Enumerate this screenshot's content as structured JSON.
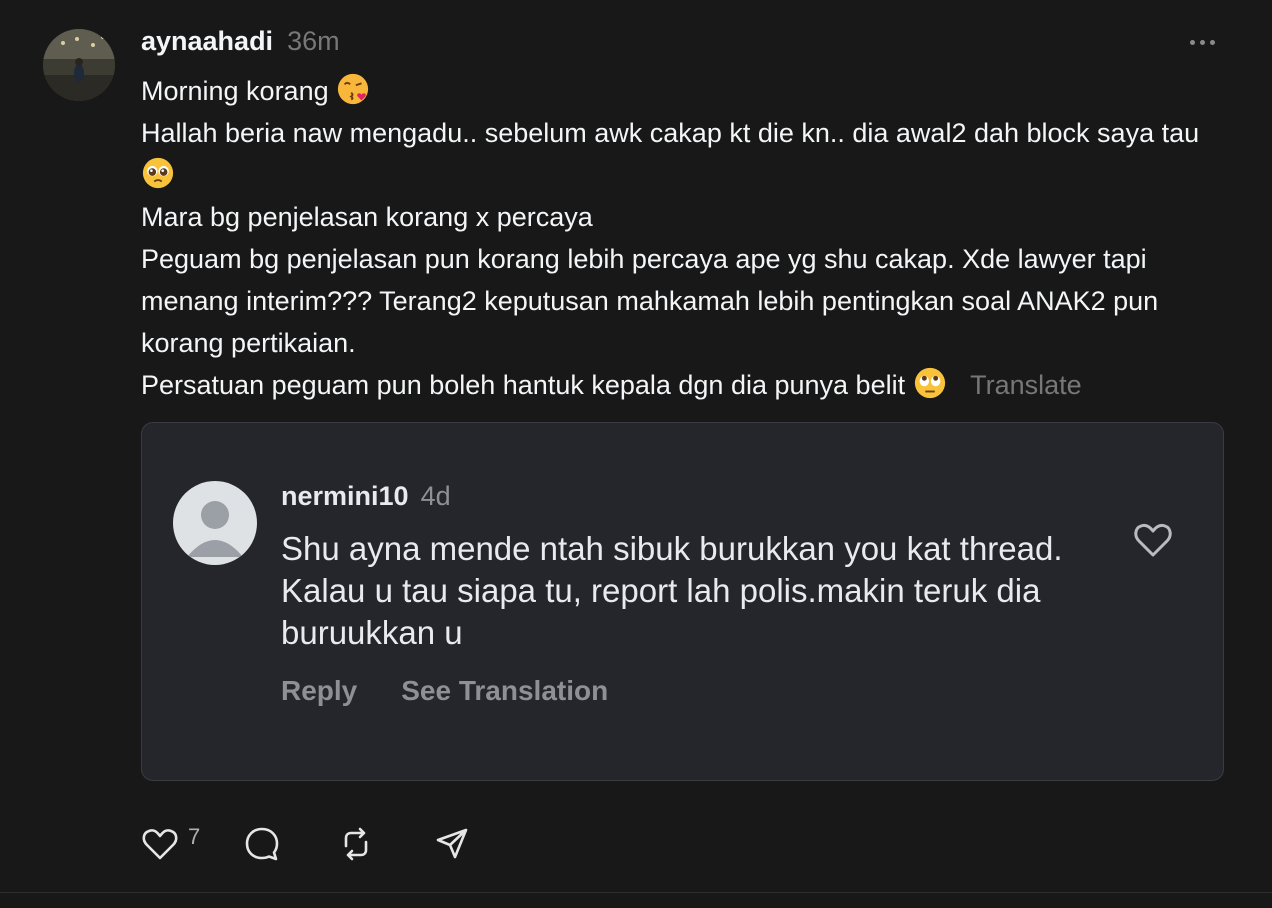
{
  "post": {
    "username": "aynaahadi",
    "time": "36m",
    "lines": [
      "Morning korang",
      "Hallah beria naw mengadu.. sebelum awk cakap kt die kn.. dia awal2 dah block saya tau",
      "Mara bg penjelasan korang x percaya",
      "Peguam bg penjelasan pun korang lebih percaya ape yg shu cakap. Xde lawyer tapi menang interim??? Terang2 keputusan mahkamah lebih pentingkan soal ANAK2 pun korang pertikaian.",
      "Persatuan peguam pun boleh hantuk kepala dgn dia punya belit"
    ],
    "translate_label": "Translate"
  },
  "quoted": {
    "username": "nermini10",
    "time": "4d",
    "text": "Shu ayna mende ntah sibuk burukkan you kat thread. Kalau u tau siapa tu, report lah polis.makin teruk dia buruukkan u",
    "reply_label": "Reply",
    "see_translation_label": "See Translation"
  },
  "actions": {
    "like_count": "7"
  },
  "icons": [
    "more-icon",
    "kiss-emoji",
    "pleading-emoji",
    "eye-roll-emoji",
    "heart-icon",
    "comment-icon",
    "repost-icon",
    "share-icon"
  ],
  "colors": {
    "background": "#181818",
    "card": "#24262b",
    "muted": "#777777"
  }
}
